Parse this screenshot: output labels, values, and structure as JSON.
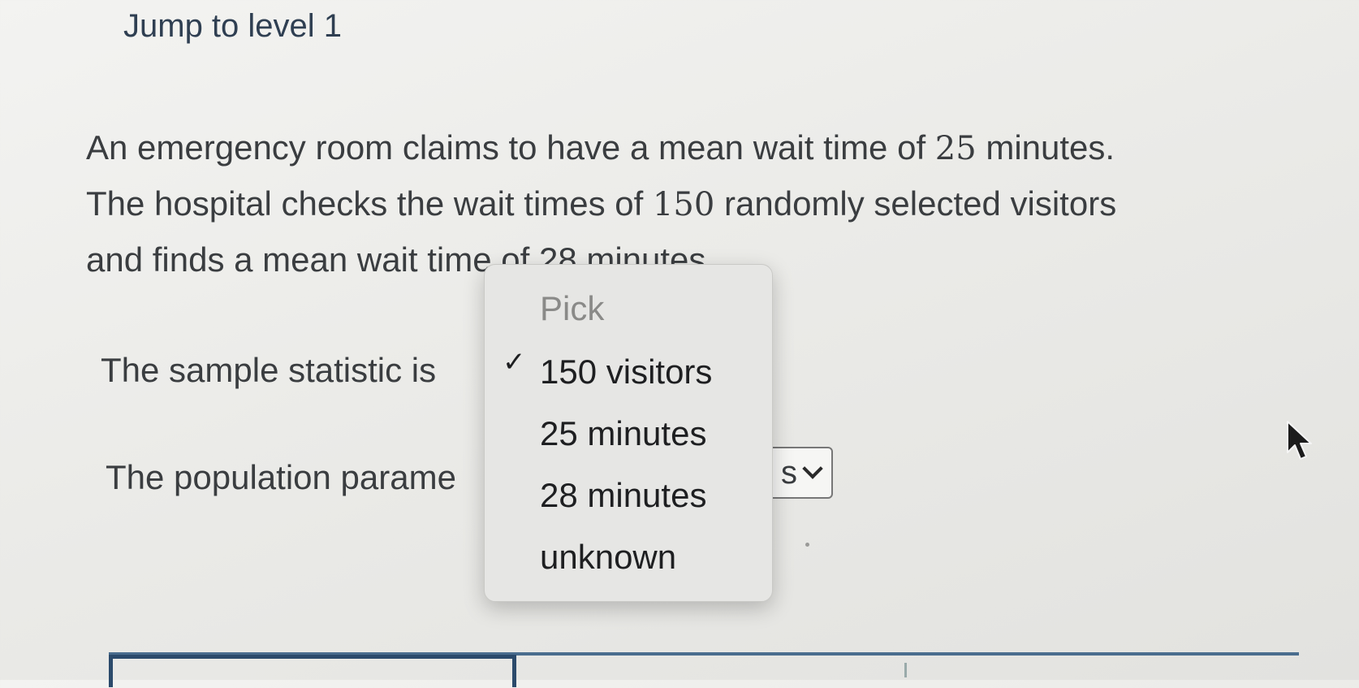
{
  "header": {
    "jump_link": "Jump to level 1"
  },
  "problem": {
    "line1_pre": "An emergency room claims to have a mean wait time of ",
    "line1_num": "25",
    "line1_post": " minutes.",
    "line2_pre": "The hospital checks the wait times of ",
    "line2_num": "150",
    "line2_post": " randomly selected visitors",
    "line3": "and finds a mean wait time of 28 minutes."
  },
  "questions": {
    "sample_label": "The sample statistic is",
    "population_label": "The population parame"
  },
  "population_select": {
    "visible_value": "s"
  },
  "dropdown": {
    "placeholder": "Pick",
    "check_glyph": "✓",
    "options": [
      "150 visitors",
      "25 minutes",
      "28 minutes",
      "unknown"
    ],
    "selected": "150 visitors"
  },
  "colors": {
    "link": "#2f3f52",
    "bottom_border": "#2b4a6b"
  },
  "icons": [
    "check-icon",
    "chevron-down-icon",
    "mouse-cursor-icon"
  ]
}
